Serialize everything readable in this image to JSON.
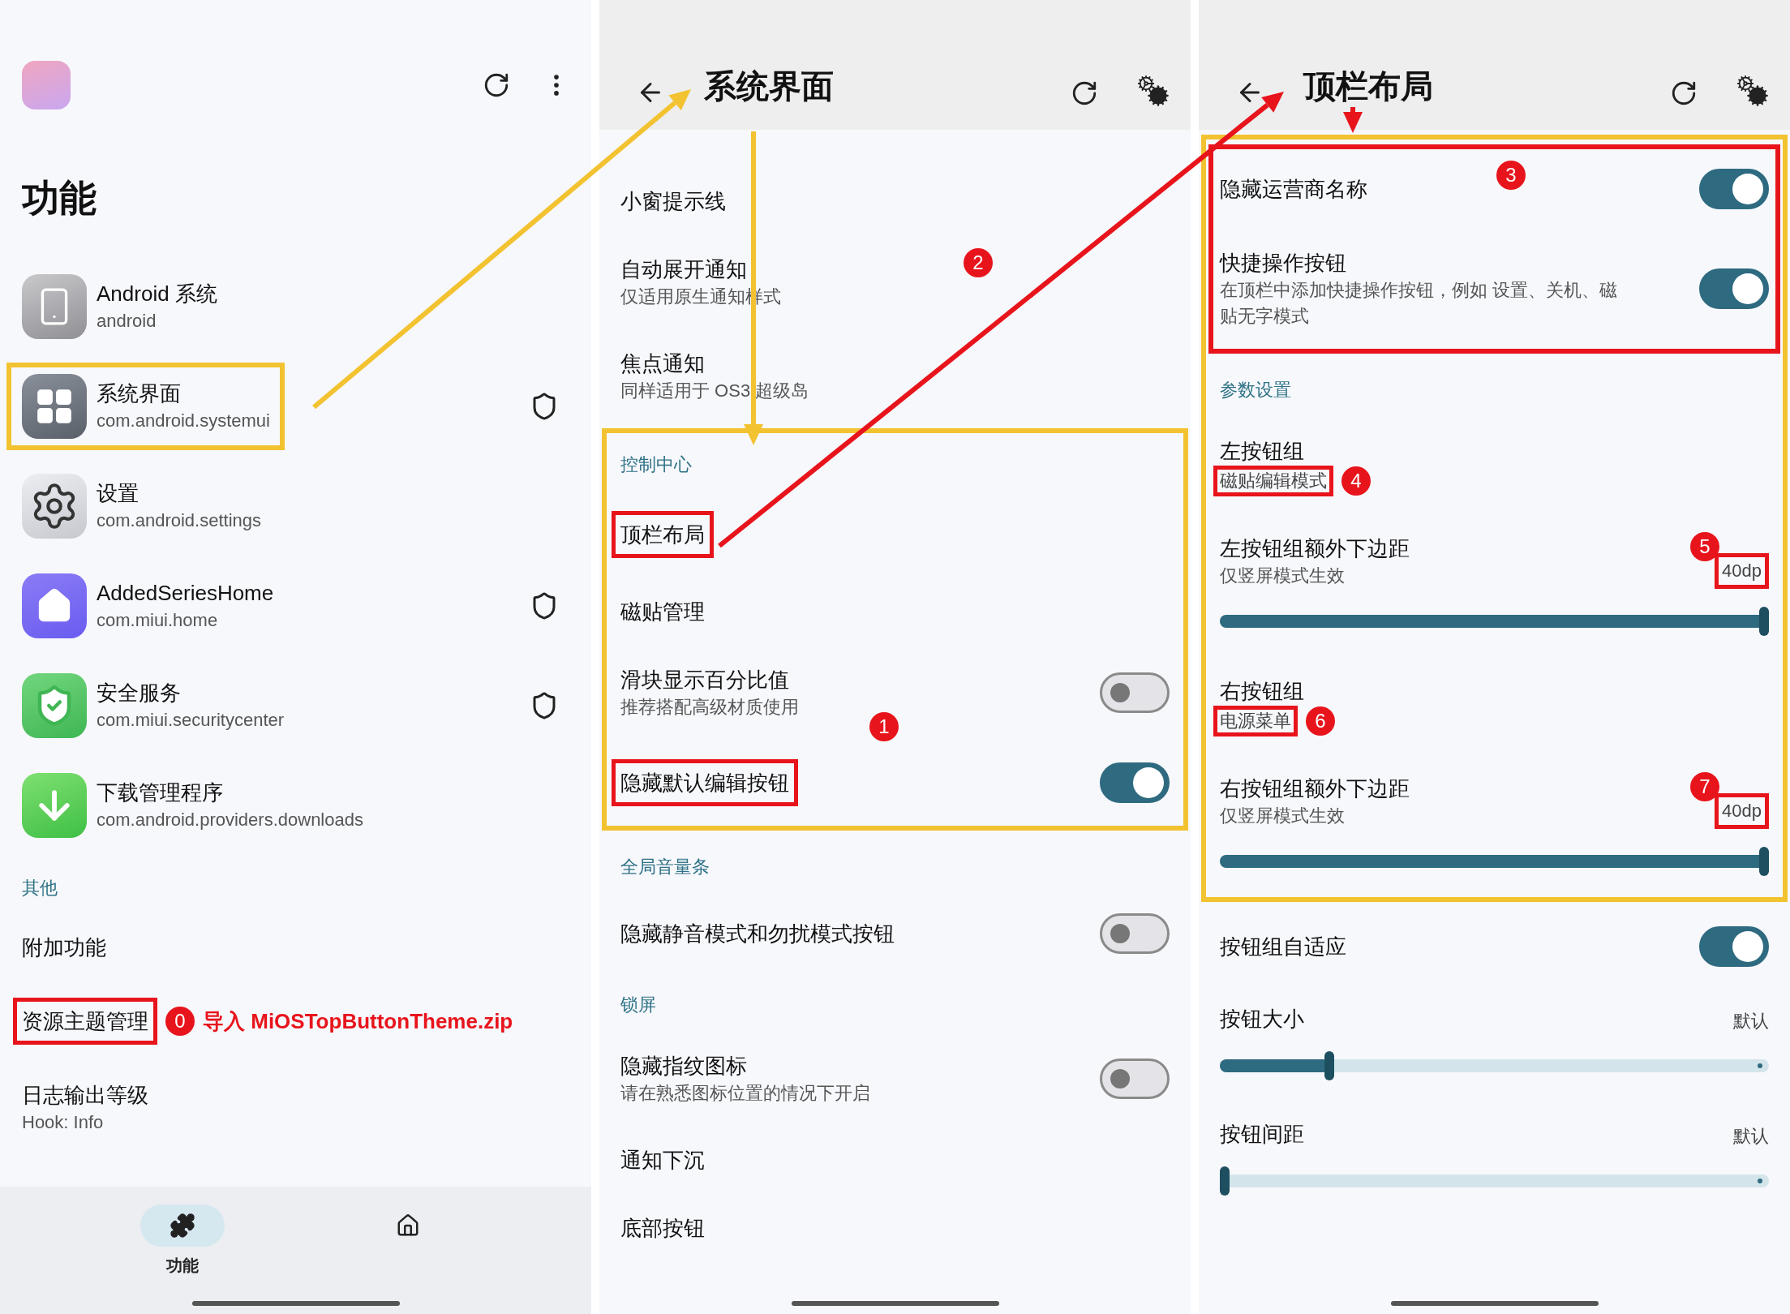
{
  "home": {
    "title": "功能",
    "apps": [
      {
        "name": "Android 系统",
        "package": "android",
        "kind": "phone"
      },
      {
        "name": "系统界面",
        "package": "com.android.systemui",
        "kind": "grid",
        "protected": true,
        "framed": true
      },
      {
        "name": "设置",
        "package": "com.android.settings",
        "kind": "gear"
      },
      {
        "name": "AddedSeriesHome",
        "package": "com.miui.home",
        "kind": "home",
        "protected": true
      },
      {
        "name": "安全服务",
        "package": "com.miui.securitycenter",
        "kind": "shield",
        "protected": true
      },
      {
        "name": "下载管理程序",
        "package": "com.android.providers.downloads",
        "kind": "download"
      }
    ],
    "section": "其他",
    "items": [
      {
        "title": "附加功能"
      },
      {
        "title": "资源主题管理",
        "marked": true,
        "badge": "0",
        "note": "导入 MiOSTopButtonTheme.zip"
      },
      {
        "title": "日志输出等级",
        "subtitle": "Hook: Info"
      }
    ],
    "nav": [
      {
        "kind": "puzzle",
        "label": "功能",
        "selected": true
      },
      {
        "kind": "home",
        "selected": false
      }
    ]
  },
  "system_ui": {
    "title": "系统界面",
    "items": [
      {
        "kind": "link",
        "title": "小窗提示线"
      },
      {
        "kind": "link",
        "title": "自动展开通知",
        "subtitle": "仅适用原生通知样式"
      },
      {
        "kind": "link",
        "title": "焦点通知",
        "subtitle": "同样适用于 OS3 超级岛"
      },
      {
        "kind": "highlight",
        "items": [
          {
            "kind": "header",
            "title": "控制中心"
          },
          {
            "kind": "link",
            "title": "顶栏布局",
            "marked": true,
            "link_badge": "2"
          },
          {
            "kind": "link",
            "title": "磁贴管理"
          },
          {
            "kind": "toggle",
            "title": "滑块显示百分比值",
            "subtitle": "推荐搭配高级材质使用",
            "on": false
          },
          {
            "kind": "toggle",
            "title": "隐藏默认编辑按钮",
            "on": true,
            "marked": true,
            "badge": "1"
          }
        ]
      },
      {
        "kind": "header",
        "title": "全局音量条"
      },
      {
        "kind": "toggle",
        "title": "隐藏静音模式和勿扰模式按钮",
        "on": false
      },
      {
        "kind": "header",
        "title": "锁屏"
      },
      {
        "kind": "toggle",
        "title": "隐藏指纹图标",
        "subtitle": "请在熟悉图标位置的情况下开启",
        "on": false
      },
      {
        "kind": "link",
        "title": "通知下沉"
      },
      {
        "kind": "link",
        "title": "底部按钮"
      }
    ]
  },
  "top_bar_layout": {
    "title": "顶栏布局",
    "items": [
      {
        "kind": "highlight",
        "items": [
          {
            "kind": "callout",
            "badge": "3",
            "items": [
              {
                "kind": "toggle",
                "title": "隐藏运营商名称",
                "on": true
              },
              {
                "kind": "toggle",
                "title": "快捷操作按钮",
                "subtitle": "在顶栏中添加快捷操作按钮，例如 设置、关机、磁贴无字模式",
                "on": true
              }
            ]
          },
          {
            "kind": "header",
            "title": "参数设置"
          },
          {
            "kind": "choice",
            "title": "左按钮组",
            "value": "磁贴编辑模式",
            "marked": true,
            "badge": "4"
          },
          {
            "kind": "slider",
            "title": "左按钮组额外下边距",
            "subtitle": "仅竖屏模式生效",
            "value": "40dp",
            "marked": true,
            "badge": "5",
            "level": 1
          },
          {
            "kind": "choice",
            "title": "右按钮组",
            "value": "电源菜单",
            "marked": true,
            "badge": "6"
          },
          {
            "kind": "slider",
            "title": "右按钮组额外下边距",
            "subtitle": "仅竖屏模式生效",
            "value": "40dp",
            "marked": true,
            "badge": "7",
            "level": 1
          }
        ]
      },
      {
        "kind": "toggle",
        "title": "按钮组自适应",
        "on": true
      },
      {
        "kind": "slider",
        "title": "按钮大小",
        "value": "默认",
        "level": 0.2
      },
      {
        "kind": "slider",
        "title": "按钮间距",
        "value": "默认",
        "level": 0
      }
    ]
  }
}
